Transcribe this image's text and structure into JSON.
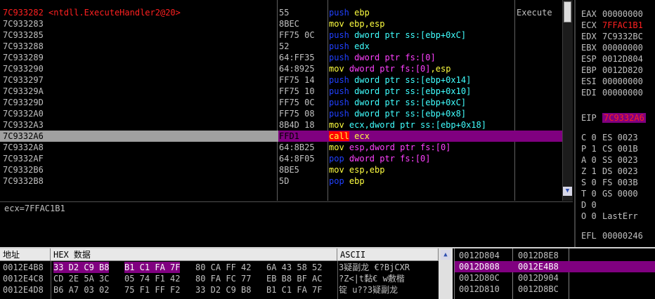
{
  "disasm": {
    "rows": [
      {
        "addr": "7C933282",
        "label": "<ntdll.ExecuteHandler2@20>",
        "hex": "55",
        "parts": [
          {
            "t": "push",
            "c": "#2040ff"
          },
          {
            "t": " ebp",
            "c": "#ffff40"
          }
        ],
        "comment": "Execute"
      },
      {
        "addr": "7C933283",
        "label": "",
        "hex": "8BEC",
        "parts": [
          {
            "t": "mov",
            "c": "#ffff40"
          },
          {
            "t": " ebp,esp",
            "c": "#ffff40"
          }
        ],
        "comment": ""
      },
      {
        "addr": "7C933285",
        "label": "",
        "hex": "FF75 0C",
        "parts": [
          {
            "t": "push",
            "c": "#2040ff"
          },
          {
            "t": " dword ptr ss:[ebp+0xC]",
            "c": "#40ffff"
          }
        ],
        "comment": ""
      },
      {
        "addr": "7C933288",
        "label": "",
        "hex": "52",
        "parts": [
          {
            "t": "push",
            "c": "#2040ff"
          },
          {
            "t": " edx",
            "c": "#40ffff"
          }
        ],
        "comment": ""
      },
      {
        "addr": "7C933289",
        "label": "",
        "hex": "64:FF35",
        "parts": [
          {
            "t": "push",
            "c": "#2040ff"
          },
          {
            "t": " dword ptr fs:[0]",
            "c": "#ff40ff"
          }
        ],
        "comment": ""
      },
      {
        "addr": "7C933290",
        "label": "",
        "hex": "64:8925",
        "parts": [
          {
            "t": "mov",
            "c": "#ffff40"
          },
          {
            "t": " dword ptr fs:[0]",
            "c": "#ff40ff"
          },
          {
            "t": ",esp",
            "c": "#ffff40"
          }
        ],
        "comment": ""
      },
      {
        "addr": "7C933297",
        "label": "",
        "hex": "FF75 14",
        "parts": [
          {
            "t": "push",
            "c": "#2040ff"
          },
          {
            "t": " dword ptr ss:[ebp+0x14]",
            "c": "#40ffff"
          }
        ],
        "comment": ""
      },
      {
        "addr": "7C93329A",
        "label": "",
        "hex": "FF75 10",
        "parts": [
          {
            "t": "push",
            "c": "#2040ff"
          },
          {
            "t": " dword ptr ss:[ebp+0x10]",
            "c": "#40ffff"
          }
        ],
        "comment": ""
      },
      {
        "addr": "7C93329D",
        "label": "",
        "hex": "FF75 0C",
        "parts": [
          {
            "t": "push",
            "c": "#2040ff"
          },
          {
            "t": " dword ptr ss:[ebp+0xC]",
            "c": "#40ffff"
          }
        ],
        "comment": ""
      },
      {
        "addr": "7C9332A0",
        "label": "",
        "hex": "FF75 08",
        "parts": [
          {
            "t": "push",
            "c": "#2040ff"
          },
          {
            "t": " dword ptr ss:[ebp+0x8]",
            "c": "#40ffff"
          }
        ],
        "comment": ""
      },
      {
        "addr": "7C9332A3",
        "label": "",
        "hex": "8B4D 18",
        "parts": [
          {
            "t": "mov",
            "c": "#ffff40"
          },
          {
            "t": " ecx,dword ptr ss:[ebp+0x18]",
            "c": "#40ffff"
          }
        ],
        "comment": ""
      },
      {
        "addr": "7C9332A6",
        "label": "",
        "hex": "FFD1",
        "parts": [
          {
            "t": "call",
            "c": "#ffff40",
            "bg": "#ff0000"
          },
          {
            "t": " ecx",
            "c": "#ffff40"
          }
        ],
        "comment": "",
        "highlight": true
      },
      {
        "addr": "7C9332A8",
        "label": "",
        "hex": "64:8B25",
        "parts": [
          {
            "t": "mov",
            "c": "#ffff40"
          },
          {
            "t": " esp,dword ptr fs:[0]",
            "c": "#ff40ff"
          }
        ],
        "comment": ""
      },
      {
        "addr": "7C9332AF",
        "label": "",
        "hex": "64:8F05",
        "parts": [
          {
            "t": "pop",
            "c": "#2040ff"
          },
          {
            "t": " dword ptr fs:[0]",
            "c": "#ff40ff"
          }
        ],
        "comment": ""
      },
      {
        "addr": "7C9332B6",
        "label": "",
        "hex": "8BE5",
        "parts": [
          {
            "t": "mov",
            "c": "#ffff40"
          },
          {
            "t": " esp,ebp",
            "c": "#ffff40"
          }
        ],
        "comment": ""
      },
      {
        "addr": "7C9332B8",
        "label": "",
        "hex": "5D",
        "parts": [
          {
            "t": "pop",
            "c": "#2040ff"
          },
          {
            "t": " ebp",
            "c": "#ffff40"
          }
        ],
        "comment": ""
      }
    ]
  },
  "info_line": "ecx=7FFAC1B1",
  "registers": {
    "gp": [
      {
        "name": "EAX",
        "value": "00000000",
        "red": false
      },
      {
        "name": "ECX",
        "value": "7FFAC1B1",
        "red": true
      },
      {
        "name": "EDX",
        "value": "7C9332BC",
        "red": false
      },
      {
        "name": "EBX",
        "value": "00000000",
        "red": false
      },
      {
        "name": "ESP",
        "value": "0012D804",
        "red": false
      },
      {
        "name": "EBP",
        "value": "0012D820",
        "red": false
      },
      {
        "name": "ESI",
        "value": "00000000",
        "red": false
      },
      {
        "name": "EDI",
        "value": "00000000",
        "red": false
      }
    ],
    "eip": {
      "name": "EIP",
      "value": "7C9332A6"
    },
    "flags": [
      {
        "f": "C",
        "fv": "0",
        "seg": "ES",
        "sv": "0023"
      },
      {
        "f": "P",
        "fv": "1",
        "seg": "CS",
        "sv": "001B"
      },
      {
        "f": "A",
        "fv": "0",
        "seg": "SS",
        "sv": "0023"
      },
      {
        "f": "Z",
        "fv": "1",
        "seg": "DS",
        "sv": "0023"
      },
      {
        "f": "S",
        "fv": "0",
        "seg": "FS",
        "sv": "003B"
      },
      {
        "f": "T",
        "fv": "0",
        "seg": "GS",
        "sv": "0000"
      },
      {
        "f": "D",
        "fv": "0",
        "seg": "",
        "sv": ""
      },
      {
        "f": "O",
        "fv": "0",
        "seg": "LastErr",
        "sv": ""
      }
    ],
    "efl": {
      "name": "EFL",
      "value": "00000246"
    }
  },
  "dump": {
    "headers": {
      "addr": "地址",
      "hex": "HEX 数据",
      "ascii": "ASCII"
    },
    "rows": [
      {
        "addr": "0012E4B8",
        "bytes": [
          "33 D2 C9 B8",
          "B1 C1 FA 7F",
          "80 CA FF 42",
          "6A 43 58 52"
        ],
        "sel": [
          true,
          true,
          false,
          false
        ],
        "ascii": "3疑副龙 €?BjCXR"
      },
      {
        "addr": "0012E4C8",
        "bytes": [
          "CD 2E 5A 3C",
          "05 74 F1 42",
          "80 FA FC 77",
          "EB B8 BF AC"
        ],
        "sel": [
          false,
          false,
          false,
          false
        ],
        "ascii": "?Z<|t黏€ w敷楷"
      },
      {
        "addr": "0012E4D8",
        "bytes": [
          "B6 A7 03 02",
          "75 F1 FF F2",
          "33 D2 C9 B8",
          "B1 C1 FA 7F"
        ],
        "sel": [
          false,
          false,
          false,
          false
        ],
        "ascii": "锭 u??3疑副龙"
      }
    ]
  },
  "stack": {
    "rows": [
      {
        "addr": "0012D804",
        "value": "0012D8E8",
        "sel": false
      },
      {
        "addr": "0012D808",
        "value": "0012E4B8",
        "sel": true
      },
      {
        "addr": "0012D80C",
        "value": "0012D904",
        "sel": false
      },
      {
        "addr": "0012D810",
        "value": "0012D8BC",
        "sel": false
      }
    ]
  }
}
